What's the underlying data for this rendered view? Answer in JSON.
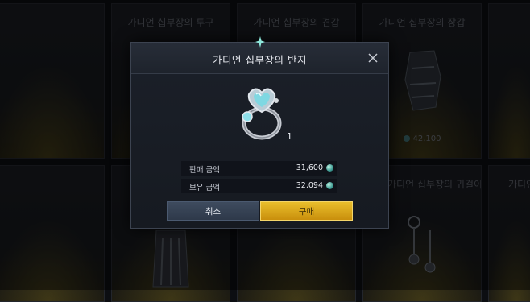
{
  "background": {
    "cards": [
      {
        "title": "",
        "price": ""
      },
      {
        "title": "가디언 십부장의 투구",
        "price": ""
      },
      {
        "title": "가디언 십부장의 견갑",
        "price": ""
      },
      {
        "title": "가디언 십부장의 장갑",
        "price": "42,100"
      },
      {
        "title": "",
        "price": ""
      },
      {
        "title": "",
        "price": ""
      },
      {
        "title": "",
        "price": ""
      },
      {
        "title": "",
        "price": ""
      },
      {
        "title": "가디언 십부장의 귀걸이",
        "price": ""
      },
      {
        "title": "가디언",
        "price": ""
      }
    ]
  },
  "dialog": {
    "title": "가디언 십부장의 반지",
    "quantity": "1",
    "sell_price_label": "판매 금액",
    "sell_price_value": "31,600",
    "owned_label": "보유 금액",
    "owned_value": "32,094",
    "cancel_label": "취소",
    "buy_label": "구매"
  },
  "colors": {
    "buy_button": "#d9a51c",
    "cancel_button": "#36425a",
    "dialog_bg": "#181c24",
    "currency_gem": "#3c9a92"
  },
  "icons": {
    "close": "close-icon",
    "item": "ring-icon",
    "currency": "gem-currency-icon",
    "header_ornament": "sparkle-icon"
  }
}
